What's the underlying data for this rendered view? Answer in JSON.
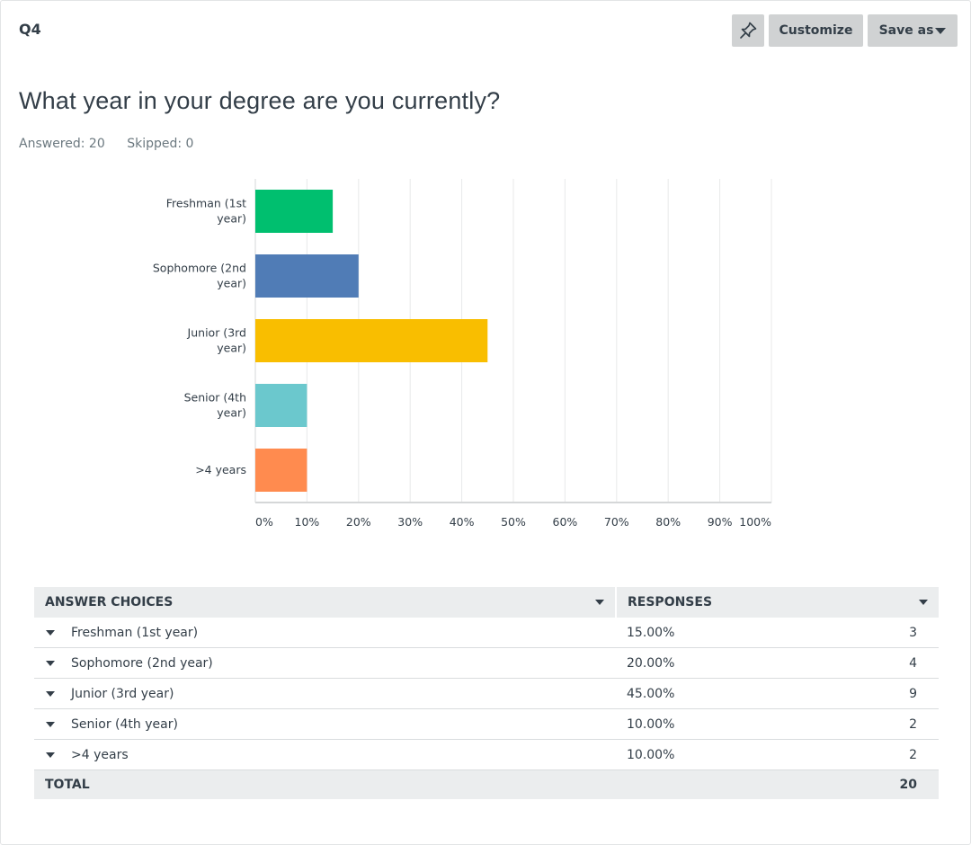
{
  "header": {
    "question_number": "Q4",
    "customize_label": "Customize",
    "save_as_label": "Save as",
    "pin_icon": "pin-icon"
  },
  "question": {
    "title": "What year in your degree are you currently?",
    "answered": "Answered: 20",
    "skipped": "Skipped: 0"
  },
  "chart_data": {
    "type": "bar",
    "orientation": "horizontal",
    "categories": [
      [
        "Freshman (1st",
        "year)"
      ],
      [
        "Sophomore (2nd",
        "year)"
      ],
      [
        "Junior (3rd",
        "year)"
      ],
      [
        "Senior (4th",
        "year)"
      ],
      [
        ">4 years"
      ]
    ],
    "values": [
      15,
      20,
      45,
      10,
      10
    ],
    "colors": [
      "#00bf6f",
      "#507cb6",
      "#f9be00",
      "#6bc8cd",
      "#ff8b4f"
    ],
    "xlim": [
      0,
      100
    ],
    "x_ticks": [
      "0%",
      "10%",
      "20%",
      "30%",
      "40%",
      "50%",
      "60%",
      "70%",
      "80%",
      "90%",
      "100%"
    ],
    "grid": true
  },
  "table": {
    "headers": [
      "ANSWER CHOICES",
      "RESPONSES"
    ],
    "rows": [
      {
        "choice": "Freshman (1st year)",
        "pct": "15.00%",
        "count": "3"
      },
      {
        "choice": "Sophomore (2nd year)",
        "pct": "20.00%",
        "count": "4"
      },
      {
        "choice": "Junior (3rd year)",
        "pct": "45.00%",
        "count": "9"
      },
      {
        "choice": "Senior (4th year)",
        "pct": "10.00%",
        "count": "2"
      },
      {
        "choice": ">4 years",
        "pct": "10.00%",
        "count": "2"
      }
    ],
    "total_label": "TOTAL",
    "total_count": "20"
  }
}
